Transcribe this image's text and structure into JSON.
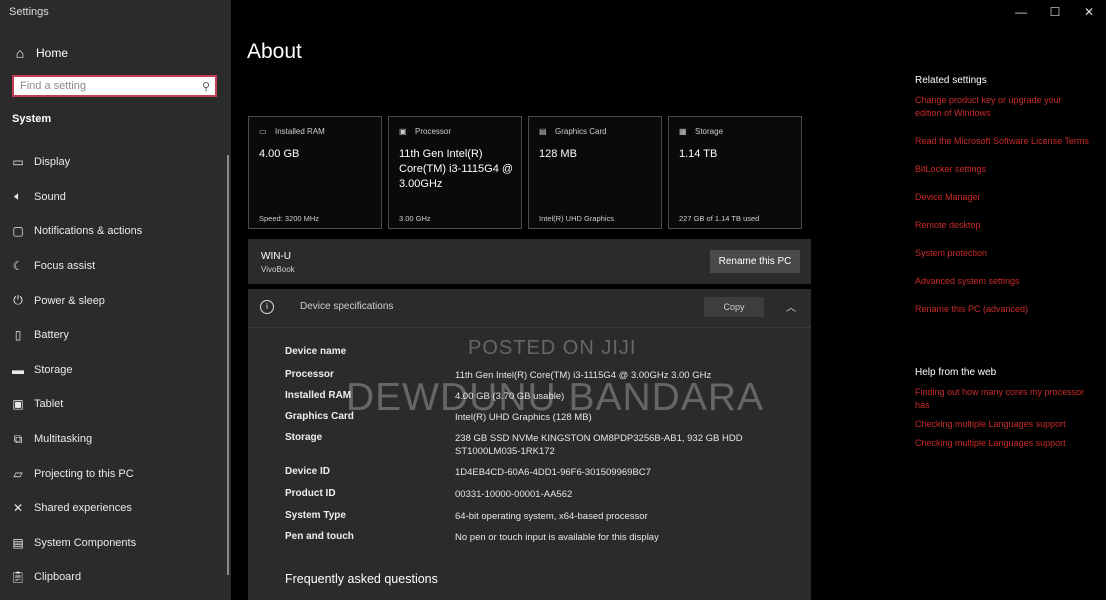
{
  "window": {
    "title": "Settings",
    "minimize": "—",
    "maximize": "☐",
    "close": "✕"
  },
  "sidebar": {
    "home_label": "Home",
    "search_placeholder": "Find a setting",
    "section": "System",
    "items": [
      {
        "label": "Display",
        "icon": "display-icon"
      },
      {
        "label": "Sound",
        "icon": "sound-icon"
      },
      {
        "label": "Notifications & actions",
        "icon": "notifications-icon"
      },
      {
        "label": "Focus assist",
        "icon": "focus-assist-icon"
      },
      {
        "label": "Power & sleep",
        "icon": "power-icon"
      },
      {
        "label": "Battery",
        "icon": "battery-icon"
      },
      {
        "label": "Storage",
        "icon": "storage-icon"
      },
      {
        "label": "Tablet",
        "icon": "tablet-icon"
      },
      {
        "label": "Multitasking",
        "icon": "multitasking-icon"
      },
      {
        "label": "Projecting to this PC",
        "icon": "projecting-icon"
      },
      {
        "label": "Shared experiences",
        "icon": "shared-experiences-icon"
      },
      {
        "label": "System Components",
        "icon": "system-components-icon"
      },
      {
        "label": "Clipboard",
        "icon": "clipboard-icon"
      }
    ]
  },
  "main": {
    "title": "About",
    "cards": [
      {
        "label": "Installed RAM",
        "value": "4.00 GB",
        "sub": "Speed: 3200 MHz",
        "icon": "ram-icon"
      },
      {
        "label": "Processor",
        "value": "11th Gen Intel(R) Core(TM) i3-1115G4 @ 3.00GHz",
        "sub": "3.00 GHz",
        "icon": "processor-icon"
      },
      {
        "label": "Graphics Card",
        "value": "128 MB",
        "sub": "Intel(R) UHD Graphics",
        "icon": "graphics-card-icon"
      },
      {
        "label": "Storage",
        "value": "1.14 TB",
        "sub": "227 GB of 1.14 TB used",
        "icon": "storage-icon"
      }
    ],
    "device": {
      "name": "WIN-U",
      "model": "VivoBook",
      "rename_button": "Rename this PC"
    },
    "specs": {
      "header": "Device specifications",
      "copy_button": "Copy",
      "rows": [
        {
          "key": "Device name",
          "value": ""
        },
        {
          "key": "Processor",
          "value": "11th Gen Intel(R) Core(TM) i3-1115G4 @ 3.00GHz   3.00 GHz"
        },
        {
          "key": "Installed RAM",
          "value": "4.00 GB (3.70 GB usable)"
        },
        {
          "key": "Graphics Card",
          "value": "Intel(R) UHD Graphics (128 MB)"
        },
        {
          "key": "Storage",
          "value": "238 GB SSD NVMe KINGSTON OM8PDP3256B-AB1, 932 GB HDD ST1000LM035-1RK172"
        },
        {
          "key": "Device ID",
          "value": "1D4EB4CD-60A6-4DD1-96F6-301509969BC7"
        },
        {
          "key": "Product ID",
          "value": "00331-10000-00001-AA562"
        },
        {
          "key": "System Type",
          "value": "64-bit operating system, x64-based processor"
        },
        {
          "key": "Pen and touch",
          "value": "No pen or touch input is available for this display"
        }
      ]
    },
    "faq": "Frequently asked questions",
    "watermark_small": "POSTED ON JIJI",
    "watermark_large": "DEWDUNU BANDARA"
  },
  "related": {
    "heading": "Related settings",
    "links": [
      "Change product key or upgrade your edition of Windows",
      "Read the Microsoft Software License Terms",
      "BitLocker settings",
      "Device Manager",
      "Remote desktop",
      "System protection",
      "Advanced system settings",
      "Rename this PC (advanced)"
    ]
  },
  "help": {
    "heading": "Help from the web",
    "links": [
      "Finding out how many cores my processor has",
      "Checking multiple Languages support",
      "Checking multiple Languages support"
    ]
  },
  "colors": {
    "accent_red": "#c92a2a",
    "search_border": "#c43f55",
    "sidebar_bg": "#2b2b2b"
  }
}
